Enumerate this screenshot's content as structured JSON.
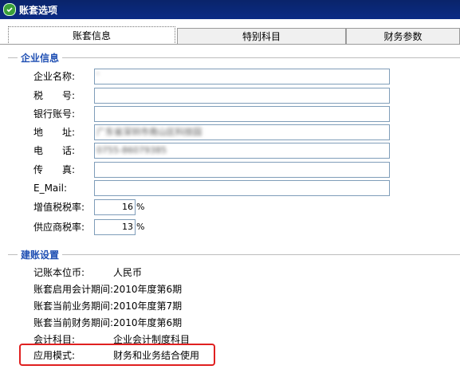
{
  "window": {
    "title": "账套选项"
  },
  "tabs": [
    {
      "label": "账套信息",
      "active": true
    },
    {
      "label": "特别科目",
      "active": false
    },
    {
      "label": "财务参数",
      "active": false
    }
  ],
  "enterprise": {
    "section_title": "企业信息",
    "fields": [
      {
        "label": "企业名称:",
        "value": "’"
      },
      {
        "label": "税　　号:",
        "value": ""
      },
      {
        "label": "银行账号:",
        "value": ""
      },
      {
        "label": "地　　址:",
        "value": "广东省深圳市南山区科技园"
      },
      {
        "label": "电　　话:",
        "value": "0755-86079385"
      },
      {
        "label": "传　　真:",
        "value": ""
      },
      {
        "label": "E_Mail:",
        "value": ""
      }
    ],
    "vat_label": "增值税税率:",
    "vat_value": "16",
    "supplier_label": "供应商税率:",
    "supplier_value": "13",
    "percent_sign": "%"
  },
  "setup": {
    "section_title": "建账设置",
    "rows": [
      {
        "label": "记账本位币:",
        "value": "人民币"
      },
      {
        "label": "账套启用会计期间:",
        "value": "2010年度第6期"
      },
      {
        "label": "账套当前业务期间:",
        "value": "2010年度第7期"
      },
      {
        "label": "账套当前财务期间:",
        "value": "2010年度第6期"
      },
      {
        "label": "会计科目:",
        "value": "企业会计制度科目"
      },
      {
        "label": "应用模式:",
        "value": "财务和业务结合使用"
      }
    ]
  },
  "colors": {
    "titlebar": "#0a246a",
    "section_title": "#1f4fb3",
    "highlight": "#e02020"
  },
  "icons": {
    "title": "app-shield-icon"
  }
}
